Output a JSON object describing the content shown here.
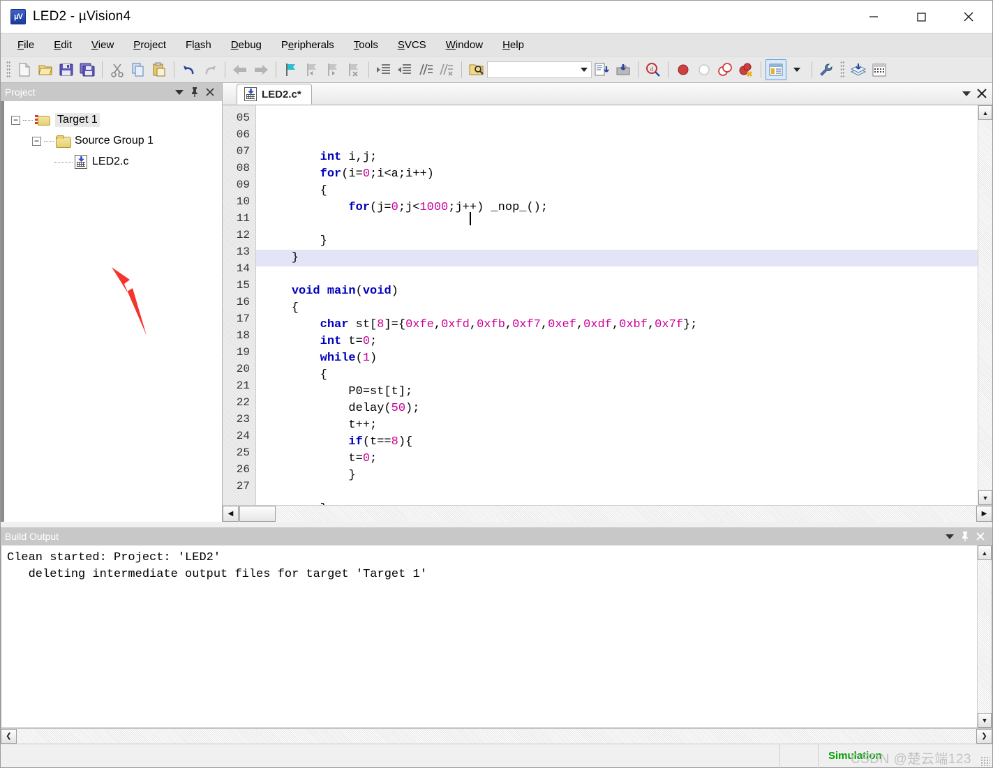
{
  "window": {
    "title": "LED2  - µVision4",
    "app_icon": "uvision-icon",
    "minimize": "—",
    "maximize": "□",
    "close": "✕"
  },
  "menubar": {
    "items": [
      {
        "label": "File",
        "accel": "F"
      },
      {
        "label": "Edit",
        "accel": "E"
      },
      {
        "label": "View",
        "accel": "V"
      },
      {
        "label": "Project",
        "accel": "P"
      },
      {
        "label": "Flash",
        "accel": "a"
      },
      {
        "label": "Debug",
        "accel": "D"
      },
      {
        "label": "Peripherals",
        "accel": "e"
      },
      {
        "label": "Tools",
        "accel": "T"
      },
      {
        "label": "SVCS",
        "accel": "S"
      },
      {
        "label": "Window",
        "accel": "W"
      },
      {
        "label": "Help",
        "accel": "H"
      }
    ]
  },
  "toolbar": {
    "buttons": [
      {
        "name": "new-file-icon",
        "glyph": "new"
      },
      {
        "name": "open-file-icon",
        "glyph": "open"
      },
      {
        "name": "save-icon",
        "glyph": "save"
      },
      {
        "name": "save-all-icon",
        "glyph": "saveall"
      },
      {
        "name": "cut-icon",
        "glyph": "cut"
      },
      {
        "name": "copy-icon",
        "glyph": "copy"
      },
      {
        "name": "paste-icon",
        "glyph": "paste"
      },
      {
        "name": "undo-icon",
        "glyph": "undo"
      },
      {
        "name": "redo-icon",
        "glyph": "redo"
      },
      {
        "name": "navigate-back-icon",
        "glyph": "back"
      },
      {
        "name": "navigate-forward-icon",
        "glyph": "forward"
      },
      {
        "name": "insert-bookmark-icon",
        "glyph": "bookmark"
      },
      {
        "name": "previous-bookmark-icon",
        "glyph": "bookmark-prev"
      },
      {
        "name": "next-bookmark-icon",
        "glyph": "bookmark-next"
      },
      {
        "name": "clear-bookmarks-icon",
        "glyph": "bookmark-clear"
      },
      {
        "name": "indent-icon",
        "glyph": "indent"
      },
      {
        "name": "outdent-icon",
        "glyph": "outdent"
      },
      {
        "name": "comment-icon",
        "glyph": "comment"
      },
      {
        "name": "uncomment-icon",
        "glyph": "uncomment"
      },
      {
        "name": "find-in-files-icon",
        "glyph": "findfiles"
      }
    ],
    "search_combo_value": "",
    "right_buttons": [
      {
        "name": "compile-icon",
        "glyph": "compile"
      },
      {
        "name": "download-icon",
        "glyph": "download"
      },
      {
        "name": "start-debug-icon",
        "glyph": "debug"
      },
      {
        "name": "insert-breakpoint-icon",
        "glyph": "bp-insert"
      },
      {
        "name": "disable-breakpoint-icon",
        "glyph": "bp-disable"
      },
      {
        "name": "disable-all-breakpoints-icon",
        "glyph": "bp-disable-all"
      },
      {
        "name": "kill-all-breakpoints-icon",
        "glyph": "bp-kill"
      },
      {
        "name": "project-window-icon",
        "glyph": "project-window"
      },
      {
        "name": "configuration-wizard-icon",
        "glyph": "wrench"
      },
      {
        "name": "manage-components-icon",
        "glyph": "components"
      },
      {
        "name": "target-options-icon",
        "glyph": "target-options"
      }
    ]
  },
  "project_panel": {
    "title": "Project",
    "collapse_icon": "chevron-down-icon",
    "pin_icon": "pin-icon",
    "close_icon": "close-icon",
    "tree": [
      {
        "label": "Target 1",
        "icon": "target-folder-icon",
        "level": 0,
        "expanded": true,
        "selected": true
      },
      {
        "label": "Source Group 1",
        "icon": "folder-icon",
        "level": 1,
        "expanded": true,
        "selected": false
      },
      {
        "label": "LED2.c",
        "icon": "c-file-icon",
        "level": 2,
        "expanded": null,
        "selected": false
      }
    ],
    "annotation": {
      "type": "red-arrow",
      "points_to": "LED2.c"
    }
  },
  "editor": {
    "tabs": [
      {
        "label": "LED2.c*",
        "icon": "c-file-icon",
        "active": true
      }
    ],
    "collapse_icon": "chevron-down-icon",
    "close_icon": "close-icon",
    "first_line_number": 5,
    "current_line": 11,
    "cursor": {
      "line": 11,
      "column": 29
    },
    "line_numbers": [
      "05",
      "06",
      "07",
      "08",
      "09",
      "10",
      "11",
      "12",
      "13",
      "14",
      "15",
      "16",
      "17",
      "18",
      "19",
      "20",
      "21",
      "22",
      "23",
      "24",
      "25",
      "26",
      "27"
    ],
    "lines": [
      {
        "n": "05",
        "tokens": [
          {
            "t": "        ",
            "c": "punc"
          },
          {
            "t": "int",
            "c": "kw"
          },
          {
            "t": " i,j;",
            "c": "punc"
          }
        ]
      },
      {
        "n": "06",
        "tokens": [
          {
            "t": "        ",
            "c": "punc"
          },
          {
            "t": "for",
            "c": "kw"
          },
          {
            "t": "(i=",
            "c": "punc"
          },
          {
            "t": "0",
            "c": "num"
          },
          {
            "t": ";i<a;i++)",
            "c": "punc"
          }
        ]
      },
      {
        "n": "07",
        "tokens": [
          {
            "t": "        {",
            "c": "punc"
          }
        ]
      },
      {
        "n": "08",
        "tokens": [
          {
            "t": "            ",
            "c": "punc"
          },
          {
            "t": "for",
            "c": "kw"
          },
          {
            "t": "(j=",
            "c": "punc"
          },
          {
            "t": "0",
            "c": "num"
          },
          {
            "t": ";j<",
            "c": "punc"
          },
          {
            "t": "1000",
            "c": "num"
          },
          {
            "t": ";j++) _nop_();",
            "c": "punc"
          }
        ]
      },
      {
        "n": "09",
        "tokens": [
          {
            "t": "",
            "c": "punc"
          }
        ]
      },
      {
        "n": "10",
        "tokens": [
          {
            "t": "        }",
            "c": "punc"
          }
        ]
      },
      {
        "n": "11",
        "tokens": [
          {
            "t": "    }",
            "c": "punc"
          }
        ]
      },
      {
        "n": "12",
        "tokens": [
          {
            "t": "",
            "c": "punc"
          }
        ]
      },
      {
        "n": "13",
        "tokens": [
          {
            "t": "    ",
            "c": "punc"
          },
          {
            "t": "void main",
            "c": "kw"
          },
          {
            "t": "(",
            "c": "punc"
          },
          {
            "t": "void",
            "c": "kw"
          },
          {
            "t": ")",
            "c": "punc"
          }
        ]
      },
      {
        "n": "14",
        "tokens": [
          {
            "t": "    {",
            "c": "punc"
          }
        ]
      },
      {
        "n": "15",
        "tokens": [
          {
            "t": "        ",
            "c": "punc"
          },
          {
            "t": "char",
            "c": "kw"
          },
          {
            "t": " st[",
            "c": "punc"
          },
          {
            "t": "8",
            "c": "num"
          },
          {
            "t": "]={",
            "c": "punc"
          },
          {
            "t": "0xfe",
            "c": "num"
          },
          {
            "t": ",",
            "c": "punc"
          },
          {
            "t": "0xfd",
            "c": "num"
          },
          {
            "t": ",",
            "c": "punc"
          },
          {
            "t": "0xfb",
            "c": "num"
          },
          {
            "t": ",",
            "c": "punc"
          },
          {
            "t": "0xf7",
            "c": "num"
          },
          {
            "t": ",",
            "c": "punc"
          },
          {
            "t": "0xef",
            "c": "num"
          },
          {
            "t": ",",
            "c": "punc"
          },
          {
            "t": "0xdf",
            "c": "num"
          },
          {
            "t": ",",
            "c": "punc"
          },
          {
            "t": "0xbf",
            "c": "num"
          },
          {
            "t": ",",
            "c": "punc"
          },
          {
            "t": "0x7f",
            "c": "num"
          },
          {
            "t": "};",
            "c": "punc"
          }
        ]
      },
      {
        "n": "16",
        "tokens": [
          {
            "t": "        ",
            "c": "punc"
          },
          {
            "t": "int",
            "c": "kw"
          },
          {
            "t": " t=",
            "c": "punc"
          },
          {
            "t": "0",
            "c": "num"
          },
          {
            "t": ";",
            "c": "punc"
          }
        ]
      },
      {
        "n": "17",
        "tokens": [
          {
            "t": "        ",
            "c": "punc"
          },
          {
            "t": "while",
            "c": "kw"
          },
          {
            "t": "(",
            "c": "punc"
          },
          {
            "t": "1",
            "c": "num"
          },
          {
            "t": ")",
            "c": "punc"
          }
        ]
      },
      {
        "n": "18",
        "tokens": [
          {
            "t": "        {",
            "c": "punc"
          }
        ]
      },
      {
        "n": "19",
        "tokens": [
          {
            "t": "            P0=st[t];",
            "c": "punc"
          }
        ]
      },
      {
        "n": "20",
        "tokens": [
          {
            "t": "            delay(",
            "c": "punc"
          },
          {
            "t": "50",
            "c": "num"
          },
          {
            "t": ");",
            "c": "punc"
          }
        ]
      },
      {
        "n": "21",
        "tokens": [
          {
            "t": "            t++;",
            "c": "punc"
          }
        ]
      },
      {
        "n": "22",
        "tokens": [
          {
            "t": "            ",
            "c": "punc"
          },
          {
            "t": "if",
            "c": "kw"
          },
          {
            "t": "(t==",
            "c": "punc"
          },
          {
            "t": "8",
            "c": "num"
          },
          {
            "t": "){",
            "c": "punc"
          }
        ]
      },
      {
        "n": "23",
        "tokens": [
          {
            "t": "            t=",
            "c": "punc"
          },
          {
            "t": "0",
            "c": "num"
          },
          {
            "t": ";",
            "c": "punc"
          }
        ]
      },
      {
        "n": "24",
        "tokens": [
          {
            "t": "            }",
            "c": "punc"
          }
        ]
      },
      {
        "n": "25",
        "tokens": [
          {
            "t": "",
            "c": "punc"
          }
        ]
      },
      {
        "n": "26",
        "tokens": [
          {
            "t": "        }",
            "c": "punc"
          }
        ]
      },
      {
        "n": "27",
        "tokens": [
          {
            "t": "    }",
            "c": "punc"
          }
        ]
      }
    ]
  },
  "build_output": {
    "title": "Build Output",
    "collapse_icon": "chevron-down-icon",
    "pin_icon": "pin-icon",
    "close_icon": "close-icon",
    "lines": [
      "Clean started: Project: 'LED2'",
      "   deleting intermediate output files for target 'Target 1'"
    ]
  },
  "statusbar": {
    "simulation_label": "Simulation",
    "watermark": "CSDN @楚云端123"
  },
  "colors": {
    "keyword": "#0000c0",
    "number": "#cc0099",
    "current_line": "#e4e4f7",
    "simulation_green": "#00a000",
    "annotation_red": "#f4352c",
    "panel_header": "#c8c8c8",
    "accent_blue": "#5a9bd9"
  }
}
